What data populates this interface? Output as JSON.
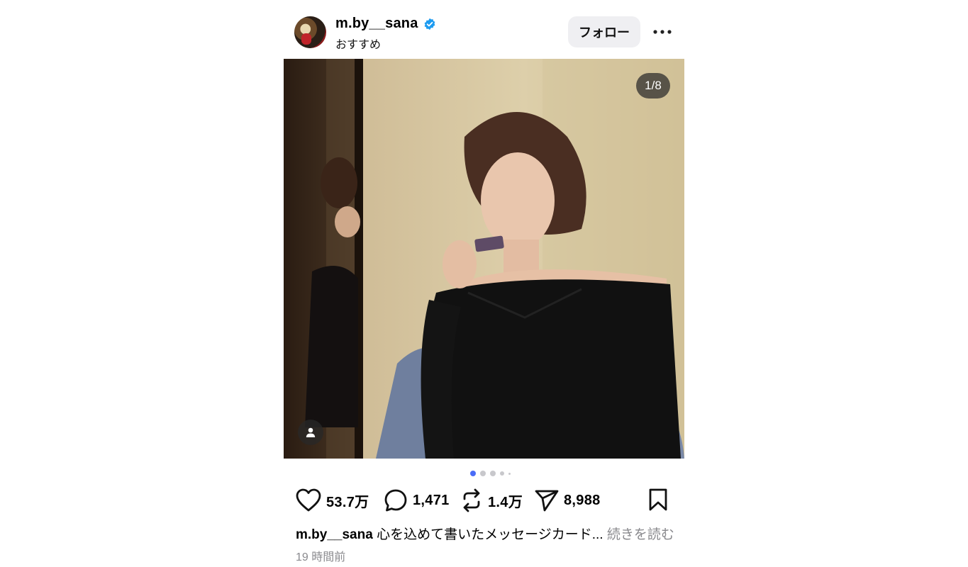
{
  "post": {
    "username": "m.by__sana",
    "subtitle": "おすすめ",
    "follow_label": "フォロー",
    "more_icon": "more-horizontal-icon",
    "image": {
      "counter": "1/8",
      "tag_icon": "user-tag-icon"
    },
    "carousel": {
      "total_visible_dots": 5,
      "active_index": 0
    },
    "actions": {
      "likes": "53.7万",
      "comments": "1,471",
      "reposts": "1.4万",
      "shares": "8,988"
    },
    "caption": {
      "user": "m.by__sana",
      "text": " 心を込めて書いたメッセージカード... ",
      "more": "続きを読む"
    },
    "timestamp": "19 時間前"
  },
  "colors": {
    "verified": "#1d9bf0",
    "active_dot": "#4a6cf7"
  }
}
